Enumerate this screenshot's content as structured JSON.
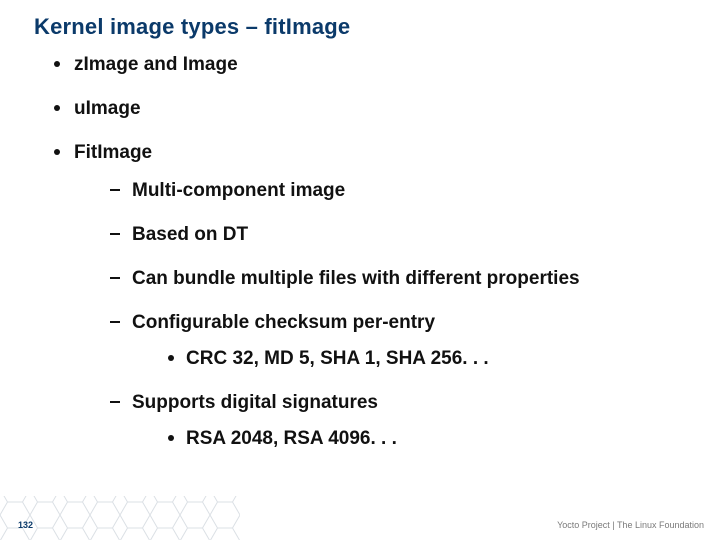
{
  "title": "Kernel image types – fitImage",
  "bullets_l1": [
    {
      "text": "zImage and Image"
    },
    {
      "text": "uImage"
    },
    {
      "text": "FitImage",
      "children": [
        {
          "text": "Multi-component image"
        },
        {
          "text": "Based on DT"
        },
        {
          "text": "Can bundle multiple files with different properties"
        },
        {
          "text": "Configurable checksum per-entry",
          "children": [
            {
              "text": "CRC 32, MD 5, SHA 1, SHA 256. . ."
            }
          ]
        },
        {
          "text": "Supports digital signatures",
          "children": [
            {
              "text": "RSA 2048, RSA 4096. . ."
            }
          ]
        }
      ]
    }
  ],
  "page_number": "132",
  "credit": "Yocto Project | The Linux Foundation",
  "colors": {
    "title": "#0b3a6a",
    "text": "#111111",
    "hex_stroke": "#d0d8de",
    "credit": "#7a7a7a"
  }
}
